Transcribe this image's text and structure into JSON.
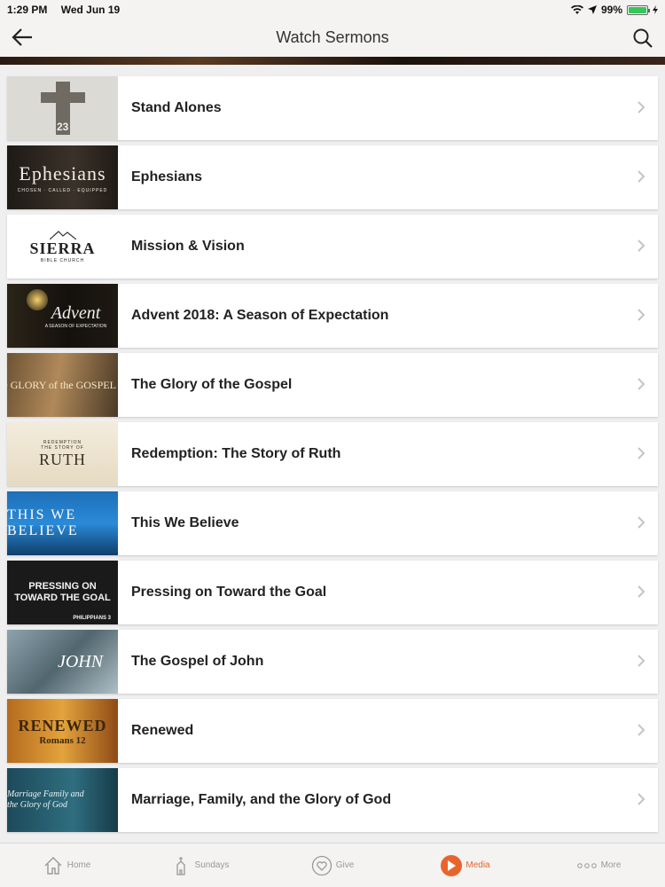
{
  "status_bar": {
    "time": "1:29 PM",
    "date": "Wed Jun 19",
    "battery": "99%",
    "battery_level": 0.99
  },
  "nav": {
    "title": "Watch Sermons"
  },
  "sermons": [
    {
      "label": "Stand Alones",
      "thumb": {
        "text": "23"
      }
    },
    {
      "label": "Ephesians",
      "thumb": {
        "title": "Ephesians",
        "subtitle": "CHOSEN · CALLED · EQUIPPED"
      }
    },
    {
      "label": "Mission & Vision",
      "thumb": {
        "title": "SIERRA",
        "subtitle": "BIBLE CHURCH"
      }
    },
    {
      "label": "Advent 2018: A Season of Expectation",
      "thumb": {
        "title": "Advent",
        "subtitle": "A SEASON OF EXPECTATION"
      }
    },
    {
      "label": "The Glory of the Gospel",
      "thumb": {
        "title": "The GLORY of the GOSPEL"
      }
    },
    {
      "label": "Redemption: The Story of Ruth",
      "thumb": {
        "pre": "REDEMPTION",
        "mid": "THE STORY OF",
        "title": "RUTH"
      }
    },
    {
      "label": "This We Believe",
      "thumb": {
        "title": "THIS WE BELIEVE"
      }
    },
    {
      "label": "Pressing on Toward the Goal",
      "thumb": {
        "title": "PRESSING ON TOWARD THE GOAL",
        "subtitle": "PHILIPPIANS 3"
      }
    },
    {
      "label": "The Gospel of John",
      "thumb": {
        "title": "JOHN"
      }
    },
    {
      "label": "Renewed",
      "thumb": {
        "title": "RENEWED",
        "subtitle": "Romans 12"
      }
    },
    {
      "label": "Marriage, Family, and the Glory of God",
      "thumb": {
        "title": "Marriage Family and the Glory of God"
      }
    }
  ],
  "tabs": [
    {
      "label": "Home",
      "icon": "home-icon"
    },
    {
      "label": "Sundays",
      "icon": "church-icon"
    },
    {
      "label": "Give",
      "icon": "heart-icon"
    },
    {
      "label": "Media",
      "icon": "play-icon",
      "active": true
    },
    {
      "label": "More",
      "icon": "more-icon"
    }
  ],
  "colors": {
    "accent": "#e8642c",
    "bar_bg": "#f4f3f1",
    "list_bg": "#efefef"
  }
}
